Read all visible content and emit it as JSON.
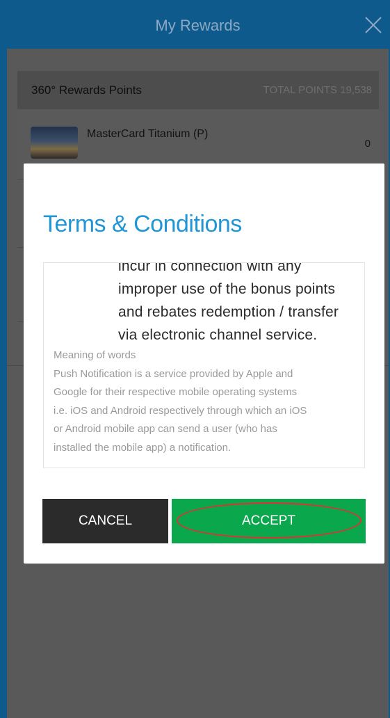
{
  "header": {
    "title": "My Rewards",
    "close_icon": "close-icon"
  },
  "rewards": {
    "points_label": "360° Rewards Points",
    "total_points": "TOTAL POINTS 19,538",
    "card": {
      "name": "MasterCard Titanium (P)",
      "points": "0"
    }
  },
  "modal": {
    "title": "Terms & Conditions",
    "terms_cut_line": "incur in connection with any",
    "terms_lines": [
      "improper use of the bonus points",
      "and rebates redemption / transfer",
      "via electronic channel service."
    ],
    "meaning_heading": "Meaning of words",
    "meaning_lines": [
      "Push Notification is a service provided by Apple and",
      "Google for their respective mobile operating systems",
      "i.e. iOS and Android respectively through which an iOS",
      "or Android mobile app can send a user (who has",
      "installed the mobile app) a notification."
    ],
    "cancel_label": "CANCEL",
    "accept_label": "ACCEPT"
  },
  "colors": {
    "header_bg": "#0f5a8c",
    "title_blue": "#2196d6",
    "accept_green": "#0aa74d",
    "cancel_dark": "#2b2b2b",
    "highlight_red": "#dd3333"
  }
}
